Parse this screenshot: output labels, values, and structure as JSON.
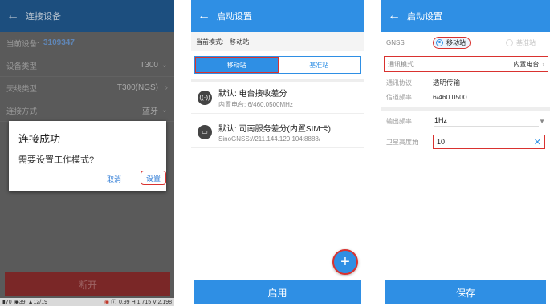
{
  "panel1": {
    "title": "连接设备",
    "back_icon": "arrow-left-icon",
    "current_device": {
      "label": "当前设备:",
      "value": "3109347"
    },
    "rows": [
      {
        "label": "设备类型",
        "value": "T300"
      },
      {
        "label": "天线类型",
        "value": "T300(NGS)"
      },
      {
        "label": "连接方式",
        "value": "蓝牙"
      }
    ],
    "dialog": {
      "title": "连接成功",
      "message": "需要设置工作模式?",
      "cancel_label": "取消",
      "setup_label": "设置"
    },
    "disconnect_label": "断开",
    "status": {
      "battery": "70",
      "satellites": "39",
      "count": "12/19",
      "hrms": "0.99",
      "h": "1.715",
      "v": "2.198"
    }
  },
  "panel2": {
    "title": "启动设置",
    "back_icon": "arrow-left-icon",
    "mode": {
      "label": "当前模式:",
      "value": "移动站"
    },
    "tabs": [
      "移动站",
      "基准站"
    ],
    "options": [
      {
        "icon": "radio-icon",
        "title": "默认: 电台接收差分",
        "subtitle": "内置电台: 6/460.0500MHz"
      },
      {
        "icon": "sim-card-icon",
        "title": "默认: 司南服务差分(内置SIM卡)",
        "subtitle": "SinoGNSS://211.144.120.104:8888/"
      }
    ],
    "fab_symbol": "+",
    "start_label": "启用"
  },
  "panel3": {
    "title": "启动设置",
    "back_icon": "arrow-left-icon",
    "gnss": {
      "label": "GNSS",
      "options": [
        "移动站",
        "基准站"
      ],
      "selected": "移动站"
    },
    "comm_mode": {
      "label": "通讯模式",
      "value": "内置电台"
    },
    "protocol": {
      "label": "通讯协议",
      "value": "透明传输"
    },
    "channel": {
      "label": "信道频率",
      "value": "6/460.0500"
    },
    "output_freq": {
      "label": "输出频率",
      "value": "1Hz"
    },
    "elevation": {
      "label": "卫星高度角",
      "value": "10"
    },
    "save_label": "保存"
  }
}
